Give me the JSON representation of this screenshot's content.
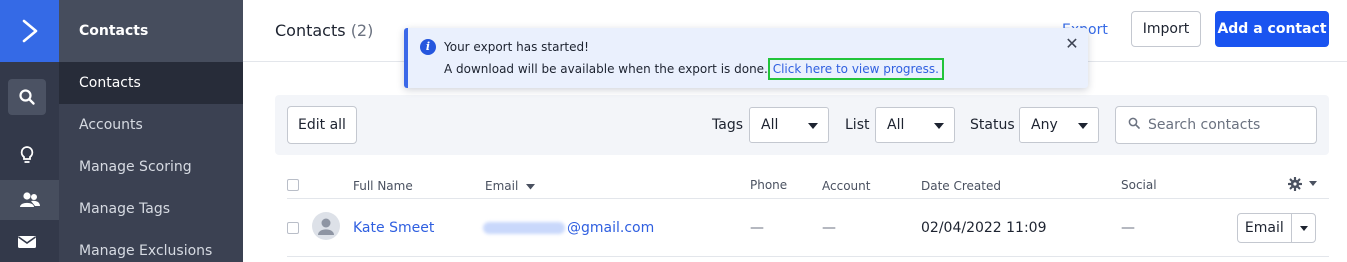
{
  "rail": {
    "icons": [
      "logo-chevron-icon",
      "search-icon",
      "lightbulb-icon",
      "contacts-icon",
      "mail-icon"
    ]
  },
  "subnav": {
    "heading": "Contacts",
    "items": [
      {
        "label": "Contacts",
        "active": true
      },
      {
        "label": "Accounts",
        "active": false
      },
      {
        "label": "Manage Scoring",
        "active": false
      },
      {
        "label": "Manage Tags",
        "active": false
      },
      {
        "label": "Manage Exclusions",
        "active": false
      }
    ]
  },
  "header": {
    "title": "Contacts",
    "count": "(2)",
    "export_label": "Export",
    "import_label": "Import",
    "add_contact_label": "Add a contact"
  },
  "toast": {
    "title": "Your export has started!",
    "body": "A download will be available when the export is done.",
    "link": "Click here to view progress.",
    "close_icon": "close-icon"
  },
  "filters": {
    "edit_all_label": "Edit all",
    "tags_label": "Tags",
    "tags_value": "All",
    "list_label": "List",
    "list_value": "All",
    "status_label": "Status",
    "status_value": "Any",
    "search_placeholder": "Search contacts"
  },
  "table": {
    "columns": [
      "Full Name",
      "Email",
      "Phone",
      "Account",
      "Date Created",
      "Social"
    ],
    "rows": [
      {
        "name": "Kate Smeet",
        "email_visible": "@gmail.com",
        "phone": "—",
        "account": "—",
        "date_created": "02/04/2022 11:09",
        "social": "—",
        "action_label": "Email"
      }
    ]
  },
  "colors": {
    "accent": "#1a54f0",
    "rail_bg": "#33394a",
    "subnav_bg": "#3b4152",
    "toast_bg": "#eaf0fd",
    "highlight": "#22c43a"
  }
}
